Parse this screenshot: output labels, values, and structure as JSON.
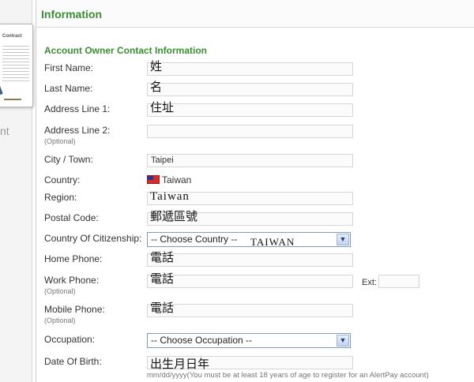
{
  "left_strip": {
    "contract_title": "Contract",
    "side_text": "nt"
  },
  "panel": {
    "title": "Information",
    "section_title": "Account Owner Contact Information"
  },
  "form": {
    "first_name": {
      "label": "First Name:",
      "value": "姓"
    },
    "last_name": {
      "label": "Last Name:",
      "value": "名"
    },
    "address1": {
      "label": "Address Line 1:",
      "value": "住址"
    },
    "address2": {
      "label": "Address Line 2:",
      "optional": "(Optional)",
      "value": ""
    },
    "city": {
      "label": "City / Town:",
      "value": "Taipei"
    },
    "country": {
      "label": "Country:",
      "value": "Taiwan",
      "flag_icon": "taiwan-flag-icon"
    },
    "region": {
      "label": "Region:",
      "value": "Taiwan"
    },
    "postal": {
      "label": "Postal Code:",
      "value": "郵遞區號"
    },
    "citizenship": {
      "label": "Country Of Citizenship:",
      "selected": "-- Choose Country --",
      "overlay": "TAIWAN"
    },
    "home_phone": {
      "label": "Home Phone:",
      "value": "電話"
    },
    "work_phone": {
      "label": "Work Phone:",
      "optional": "(Optional)",
      "value": "電話",
      "ext_label": "Ext:",
      "ext_value": ""
    },
    "mobile_phone": {
      "label": "Mobile Phone:",
      "optional": "(Optional)",
      "value": "電話"
    },
    "occupation": {
      "label": "Occupation:",
      "selected": "-- Choose Occupation --"
    },
    "dob": {
      "label": "Date Of Birth:",
      "value": "出生月日年",
      "hint": "mm/dd/yyyy(You must be at least 18 years of age to register for an AlertPay account)"
    }
  },
  "colors": {
    "accent_green": "#3a8d32",
    "field_border": "#d6d6d6",
    "select_border": "#7f9db9"
  }
}
